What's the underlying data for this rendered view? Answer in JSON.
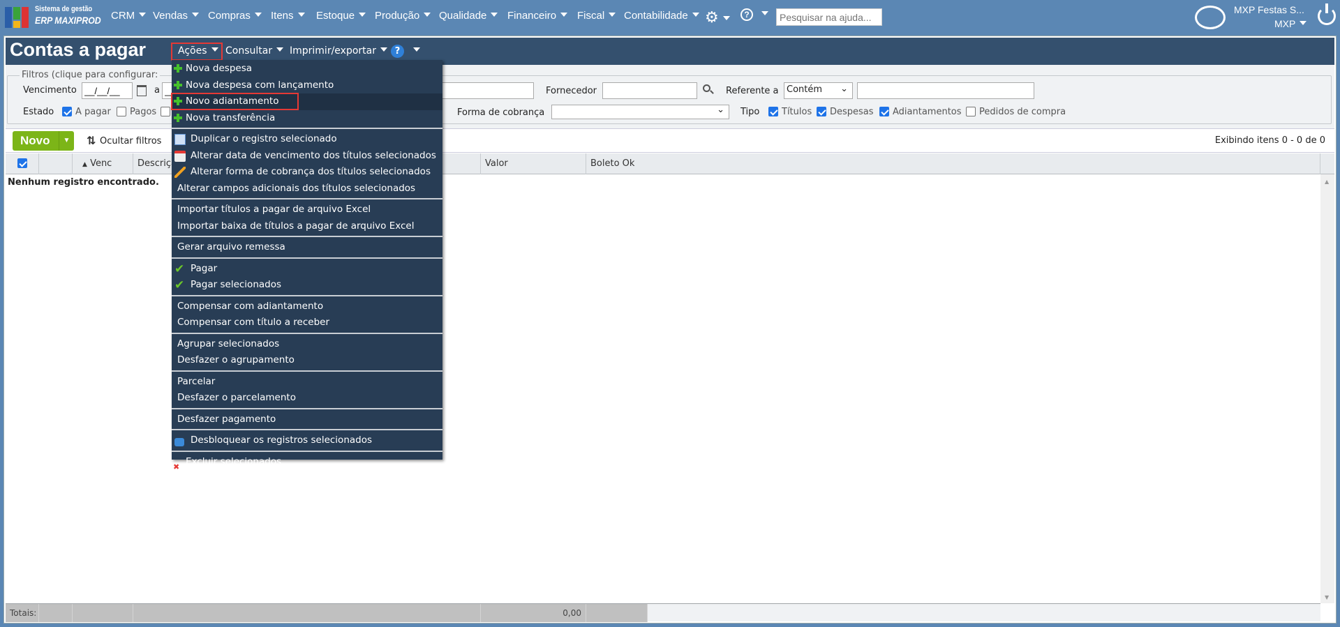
{
  "app": {
    "brand_line1": "Sistema de gestão",
    "brand_line2": "ERP MAXIPROD"
  },
  "topnav": {
    "items": [
      "CRM",
      "Vendas",
      "Compras",
      "Itens",
      "Estoque",
      "Produção",
      "Qualidade",
      "Financeiro",
      "Fiscal",
      "Contabilidade"
    ],
    "search_placeholder": "Pesquisar na ajuda...",
    "user_name": "MXP Festas S...",
    "company": "MXP"
  },
  "page": {
    "title": "Contas a pagar",
    "menus": [
      "Ações",
      "Consultar",
      "Imprimir/exportar"
    ]
  },
  "filters": {
    "legend": "Filtros (clique para configurar:",
    "vencimento_label": "Vencimento",
    "date_from": "__/__/__",
    "a_label": "a",
    "date_to": "__/__/__",
    "fornecedor_label": "Fornecedor",
    "referente_label": "Referente a",
    "referente_select": "Contém",
    "estado_label": "Estado",
    "estado": [
      {
        "label": "A pagar",
        "checked": true
      },
      {
        "label": "Pagos",
        "checked": false
      }
    ],
    "forma_label": "Forma de cobrança",
    "tipo_label": "Tipo",
    "tipo": [
      {
        "label": "Títulos",
        "checked": true
      },
      {
        "label": "Despesas",
        "checked": true
      },
      {
        "label": "Adiantamentos",
        "checked": true
      },
      {
        "label": "Pedidos de compra",
        "checked": false
      }
    ]
  },
  "toolbar": {
    "novo": "Novo",
    "ocultar_filtros": "Ocultar filtros",
    "exibindo": "Exibindo itens 0 - 0 de 0"
  },
  "table": {
    "columns": [
      "Venc",
      "Descrição",
      "Valor",
      "Boleto Ok"
    ],
    "empty": "Nenhum registro encontrado.",
    "totals_label": "Totais:",
    "total_valor": "0,00"
  },
  "menu": {
    "items": [
      {
        "label": "Nova despesa",
        "icon": "plus-icon"
      },
      {
        "label": "Nova despesa com lançamento",
        "icon": "plus-icon"
      },
      {
        "label": "Novo adiantamento",
        "icon": "plus-icon",
        "highlighted": true
      },
      {
        "label": "Nova transferência",
        "icon": "plus-icon"
      },
      {
        "label": "Duplicar o registro selecionado",
        "icon": "duplicate-icon"
      },
      {
        "label": "Alterar data de vencimento dos títulos selecionados",
        "icon": "calendar-icon"
      },
      {
        "label": "Alterar forma de cobrança dos títulos selecionados",
        "icon": "pencil-icon"
      },
      {
        "label": "Alterar campos adicionais dos títulos selecionados"
      },
      {
        "label": "Importar títulos a pagar de arquivo Excel"
      },
      {
        "label": "Importar baixa de títulos a pagar de arquivo Excel"
      },
      {
        "label": "Gerar arquivo remessa"
      },
      {
        "label": "Pagar",
        "icon": "check-icon"
      },
      {
        "label": "Pagar selecionados",
        "icon": "check-icon"
      },
      {
        "label": "Compensar com adiantamento"
      },
      {
        "label": "Compensar com título a receber"
      },
      {
        "label": "Agrupar selecionados"
      },
      {
        "label": "Desfazer o agrupamento"
      },
      {
        "label": "Parcelar"
      },
      {
        "label": "Desfazer o parcelamento"
      },
      {
        "label": "Desfazer pagamento"
      },
      {
        "label": "Desbloquear os registros selecionados",
        "icon": "unlock-icon"
      },
      {
        "label": "Excluir selecionados",
        "icon": "delete-icon"
      }
    ]
  },
  "colors": {
    "topbar": "#5b87b4",
    "titlebar": "#34506e",
    "menu": "#283d55",
    "novo_button": "#7cb518",
    "highlight_box": "#e53935"
  }
}
